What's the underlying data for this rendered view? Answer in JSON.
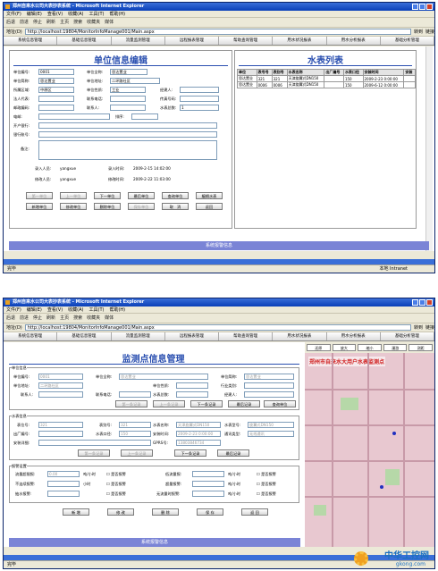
{
  "window": {
    "title": "郑州自来水公司大表抄表系统 - Microsoft Internet Explorer",
    "menu": [
      "文件(F)",
      "编辑(E)",
      "查看(V)",
      "收藏(A)",
      "工具(T)",
      "帮助(H)"
    ],
    "toolbar": [
      "后退",
      "前进",
      "停止",
      "刷新",
      "主页",
      "搜索",
      "收藏夹",
      "媒体"
    ],
    "address_label": "地址(D)",
    "address1": "http://localhost:19804/MonitorInfoManage001/Main.aspx",
    "address2": "http://localhost:19804/MonitorInfoManage001/Main.aspx",
    "go": "转到",
    "links": "链接"
  },
  "nav": [
    "系统信息管理",
    "基础信息管理",
    "流量监测管理",
    "远程报表管理",
    "帮助查询管理",
    "用水状况报表",
    "用水分析报表",
    "基础分析管理"
  ],
  "screen1": {
    "title": "单位信息编辑",
    "table_title": "水表列表",
    "fields": {
      "unit_no_label": "单位编号:",
      "unit_no": "0001",
      "full_name_label": "单位全称:",
      "full_name": "思达置业",
      "short_name_label": "单位简称:",
      "short_name": "思达置业",
      "address_label": "单位地址:",
      "address": "二环路社区",
      "district_label": "所属区域:",
      "district": "中原区",
      "nature_label": "单位性质:",
      "nature": "工业",
      "build_label": "经建人:",
      "legal_label": "法人代表:",
      "phone_label": "联系电话:",
      "fax_label": "传真号码:",
      "zip_label": "邮政编码:",
      "contact_label": "联系人:",
      "meters_label": "水表总数:",
      "meters": "1",
      "email_label": "电邮:",
      "order_label": "排序:",
      "bank_label": "开户银行:",
      "account_label": "银行账号:",
      "remark_label": "备注:",
      "entry_user_label": "录入人员:",
      "entry_user": "yangxue",
      "entry_time_label": "录入时间:",
      "entry_time": "2009-2-15 14:02:00",
      "mod_user_label": "修改人员:",
      "mod_user": "yangxue",
      "mod_time_label": "修改时间:",
      "mod_time": "2009-2-22 11:03:00"
    },
    "buttons_row1": [
      "第一单位",
      "上一单位",
      "下一单位",
      "最后单位",
      "查询单位",
      "编辑水表"
    ],
    "buttons_row2": [
      "新增单位",
      "修改单位",
      "删除单位",
      "保存单位",
      "取　消",
      "返回"
    ],
    "table_headers": [
      "单位",
      "表号号",
      "表别号",
      "水表名称",
      "出厂编号",
      "水表口径",
      "安装时间",
      "安装"
    ],
    "table_rows": [
      [
        "思达置业",
        "321",
        "321",
        "天津旋翼式DN150",
        "",
        "150",
        "2009-2-23 0:00:00",
        ""
      ],
      [
        "思达置业",
        "0006",
        "0006",
        "天津旋翼式DN150",
        "",
        "150",
        "2009-6-12 0:00:00",
        ""
      ]
    ],
    "footer": "系统报警信息",
    "status": "完毕",
    "status_right": "本地 Intranet"
  },
  "screen2": {
    "title": "监测点信息管理",
    "sec_unit": "单位信息",
    "unit_no_label": "单位编号:",
    "unit_no": "0001",
    "full_name_label": "单位全称:",
    "full_name": "思达置业",
    "short_name_label": "单位简称:",
    "short_name": "思达置业",
    "address_label": "单位地址:",
    "address": "二环路社区",
    "nature_label": "单位性质:",
    "nature": "",
    "industry_label": "行业类别:",
    "contact_label": "联系人:",
    "phone_label": "联系电话:",
    "meters_label": "水表总数:",
    "build_label": "经建人:",
    "unit_btns": [
      "第一条记录",
      "上一条记录",
      "下一条记录",
      "最后记录",
      "查询单位"
    ],
    "sec_meter": "水表信息",
    "meter_no_label": "表位号:",
    "meter_no": "321",
    "tab_no_label": "表别号:",
    "tab_no": "321",
    "meter_name_label": "水表名称:",
    "meter_name": "天津旋翼式DN150",
    "meter_type_label": "水表型号:",
    "meter_type": "旋翼式DN150",
    "factory_label": "出厂编号:",
    "caliber_label": "水表口径:",
    "caliber": "150",
    "install_label": "安装时间:",
    "install": "2009-2-23 0:00:00",
    "comm_label": "通讯类型:",
    "comm": "无线通讯",
    "addr_label": "安装详细:",
    "gprs_label": "GPRS号:",
    "gprs": "13803846734",
    "meter_btns": [
      "第一条记录",
      "上一条记录",
      "下一条记录",
      "最后记录"
    ],
    "sec_alarm": "报警设置",
    "alarm_rows": [
      [
        "流量超限报:",
        "0.00",
        "吨/小时",
        "是否报警",
        "低流量报:",
        "吨/小时",
        "是否报警"
      ],
      [
        "不连续报警:",
        "",
        "小时",
        "是否报警",
        "超量报警:",
        "吨/小时",
        "是否报警"
      ],
      [
        "抽水报警:",
        "",
        "",
        "是否报警",
        "无流量时报警:",
        "吨/小时",
        "是否报警"
      ]
    ],
    "bottom_btns": [
      "新 增",
      "修 改",
      "删 除",
      "保 存",
      "返 回"
    ],
    "map_tools": [
      "还原",
      "放大",
      "缩小",
      "漫游",
      "测距"
    ],
    "map_title": "郑州市自来水大用户水表监测点",
    "footer": "系统报警信息",
    "status": "完毕",
    "watermark": "中华工控网",
    "watermark_url": "gkong.com"
  }
}
